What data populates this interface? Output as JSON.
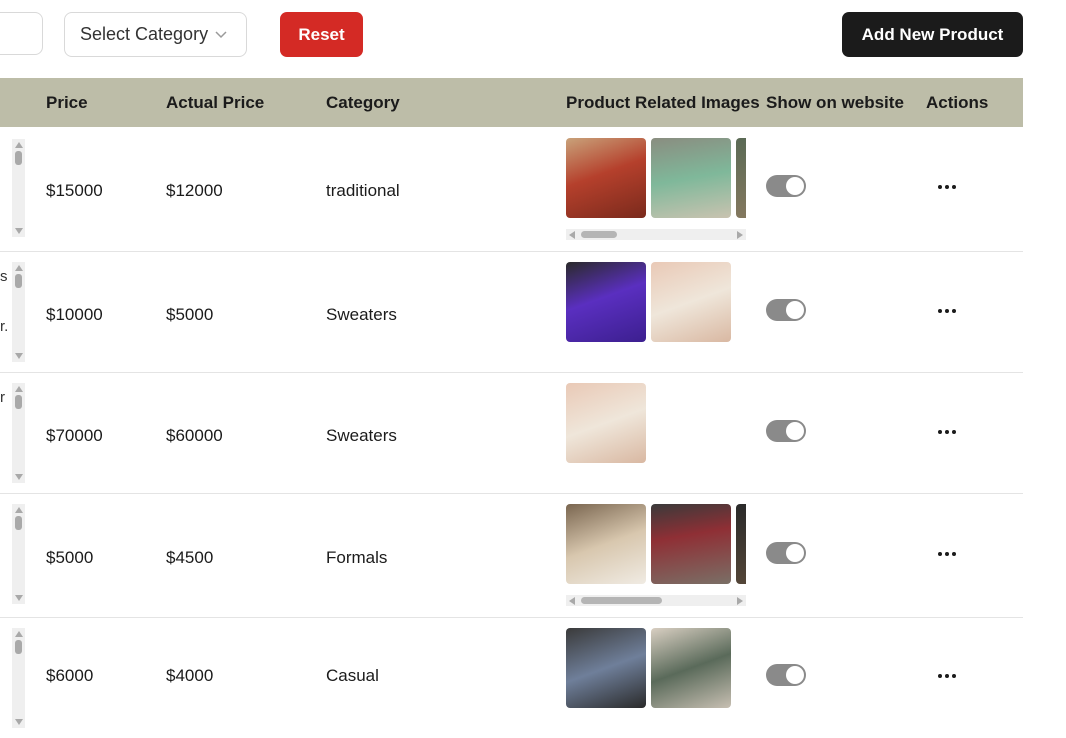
{
  "toolbar": {
    "category_select": "Select Category",
    "reset_label": "Reset",
    "add_label": "Add New Product"
  },
  "table": {
    "headers": {
      "price": "Price",
      "actual_price": "Actual Price",
      "category": "Category",
      "images": "Product Related Images",
      "show": "Show on website",
      "actions": "Actions"
    },
    "rows": [
      {
        "price": "$15000",
        "actual_price": "$12000",
        "category": "traditional",
        "image_count": 3,
        "on": true
      },
      {
        "price": "$10000",
        "actual_price": "$5000",
        "category": "Sweaters",
        "image_count": 2,
        "on": true,
        "edge_text": [
          "s",
          "r."
        ]
      },
      {
        "price": "$70000",
        "actual_price": "$60000",
        "category": "Sweaters",
        "image_count": 1,
        "on": true,
        "edge_text": [
          "r"
        ]
      },
      {
        "price": "$5000",
        "actual_price": "$4500",
        "category": "Formals",
        "image_count": 3,
        "on": true
      },
      {
        "price": "$6000",
        "actual_price": "$4000",
        "category": "Casual",
        "image_count": 2,
        "on": true
      }
    ]
  },
  "colors": {
    "header_bg": "#bdbda8",
    "reset_bg": "#d42a25",
    "add_bg": "#1b1b1b",
    "toggle_on": "#8a8a8a"
  }
}
